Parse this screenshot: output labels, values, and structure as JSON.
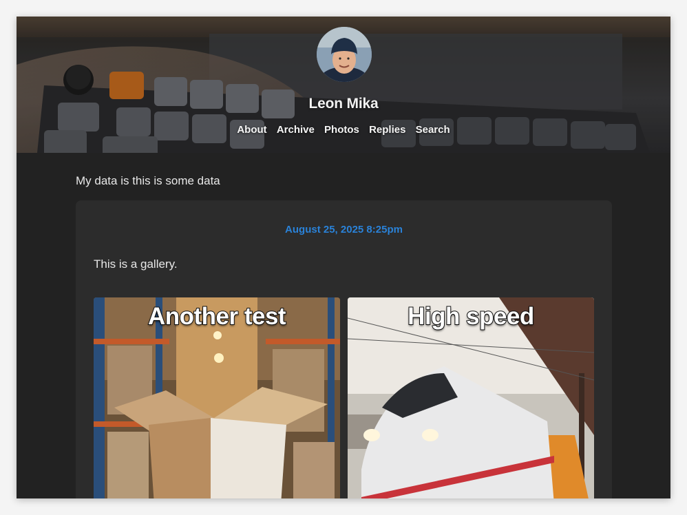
{
  "site": {
    "title": "Leon Mika",
    "nav": [
      "About",
      "Archive",
      "Photos",
      "Replies",
      "Search"
    ]
  },
  "intro_text": "My data is this is some data",
  "post": {
    "date": "August 25, 2025 8:25pm",
    "body": "This is a gallery.",
    "gallery": [
      {
        "caption": "Another test"
      },
      {
        "caption": "High speed"
      }
    ]
  },
  "colors": {
    "page_bg": "#222222",
    "card_bg": "#2c2c2c",
    "link_blue": "#2a82d8",
    "text": "#e8e8e8"
  }
}
